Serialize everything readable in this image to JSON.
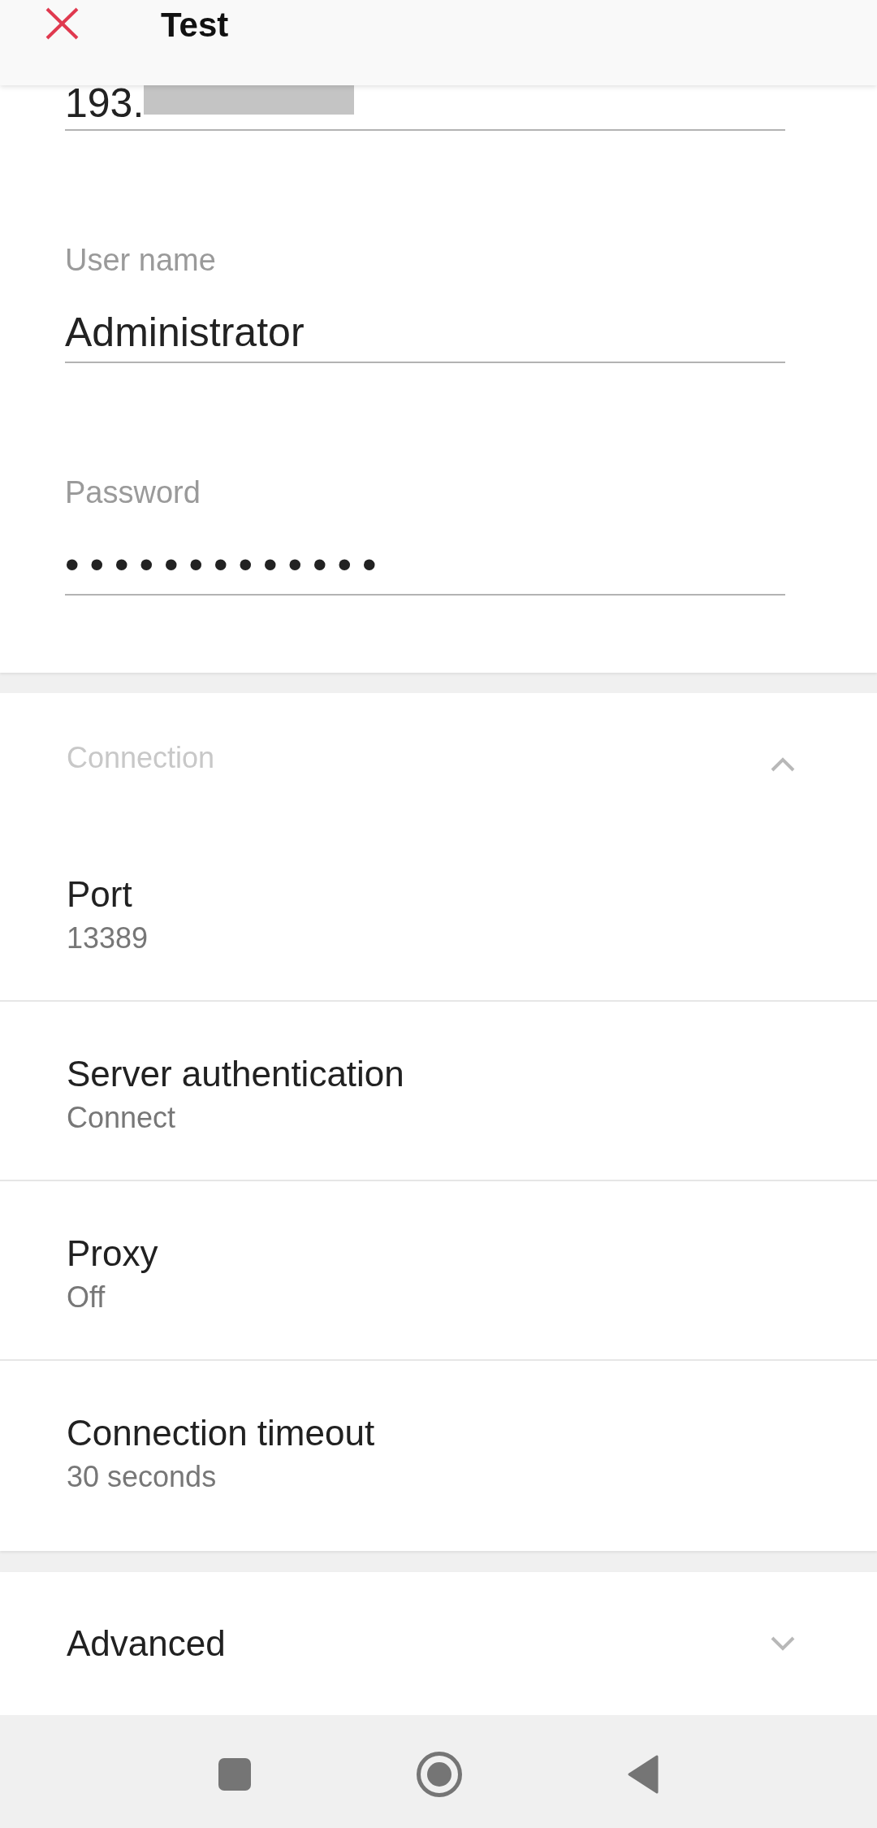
{
  "app_bar": {
    "title": "Test"
  },
  "fields": [
    {
      "kind": "text",
      "value": "193.",
      "redacted": true
    },
    {
      "kind": "text",
      "label": "User name",
      "value": "Administrator",
      "redacted": false
    },
    {
      "kind": "password",
      "label": "Password",
      "value": "•••••••••••••",
      "redacted": false
    }
  ],
  "sections": [
    {
      "title": "Connection",
      "expanded": true,
      "items": [
        {
          "title": "Port",
          "value": "13389"
        },
        {
          "title": "Server authentication",
          "value": "Connect"
        },
        {
          "title": "Proxy",
          "value": "Off"
        },
        {
          "title": "Connection timeout",
          "value": "30 seconds"
        }
      ]
    },
    {
      "title": "Advanced",
      "expanded": false
    }
  ]
}
